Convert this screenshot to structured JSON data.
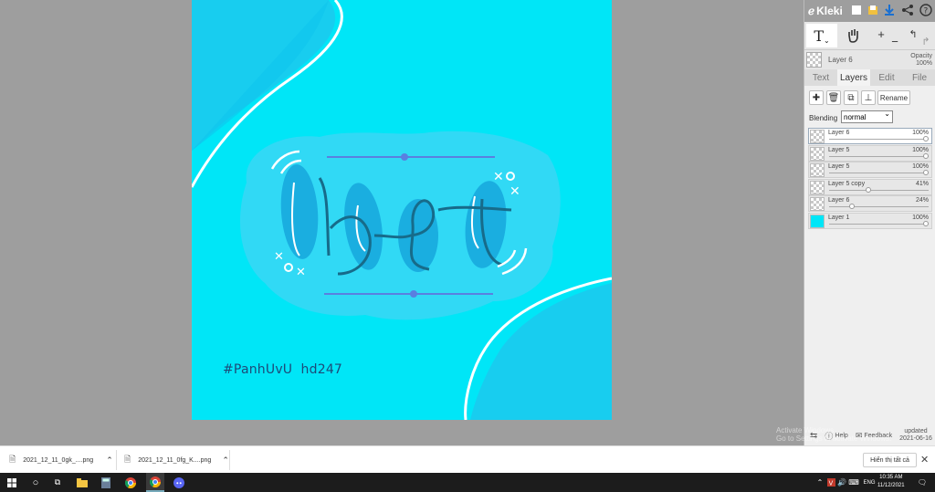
{
  "canvas": {
    "watermark": "#PanhUvU  hd247",
    "background": "#00e6f7"
  },
  "app": {
    "brand": "Kleki",
    "top_icons": [
      "new-file-icon",
      "open-file-icon",
      "download-icon",
      "share-icon",
      "help-icon"
    ]
  },
  "toolbar": {
    "text_tool": "T",
    "hand_tool": "hand-icon",
    "zoom_in": "+",
    "zoom_out": "−"
  },
  "current_layer": {
    "name": "Layer 6",
    "opacity_label": "Opacity",
    "opacity_value": "100%"
  },
  "tabs": [
    "Text",
    "Layers",
    "Edit",
    "File"
  ],
  "active_tab": "Layers",
  "layer_actions": {
    "rename": "Rename"
  },
  "blending": {
    "label": "Blending",
    "value": "normal"
  },
  "layers": [
    {
      "name": "Layer 6",
      "opacity": "100%",
      "opacity_fraction": 1.0,
      "selected": true
    },
    {
      "name": "Layer 5",
      "opacity": "100%",
      "opacity_fraction": 1.0
    },
    {
      "name": "Layer 5",
      "opacity": "100%",
      "opacity_fraction": 1.0
    },
    {
      "name": "Layer 5 copy",
      "opacity": "41%",
      "opacity_fraction": 0.41
    },
    {
      "name": "Layer 6",
      "opacity": "24%",
      "opacity_fraction": 0.24
    },
    {
      "name": "Layer 1",
      "opacity": "100%",
      "opacity_fraction": 1.0
    }
  ],
  "panel_bottom": {
    "help": "Help",
    "feedback": "Feedback",
    "updated_label": "updated",
    "updated_date": "2021-06-16"
  },
  "activate_windows": {
    "line1": "Activate Windows",
    "line2": "Go to Settings to activate Windows."
  },
  "downloads": {
    "items": [
      "2021_12_11_0gk_....png",
      "2021_12_11_0fg_K....png"
    ],
    "show_all": "Hiển thị tất cả"
  },
  "taskbar": {
    "language": "ENG",
    "time": "10:35 AM",
    "date": "11/12/2021"
  }
}
